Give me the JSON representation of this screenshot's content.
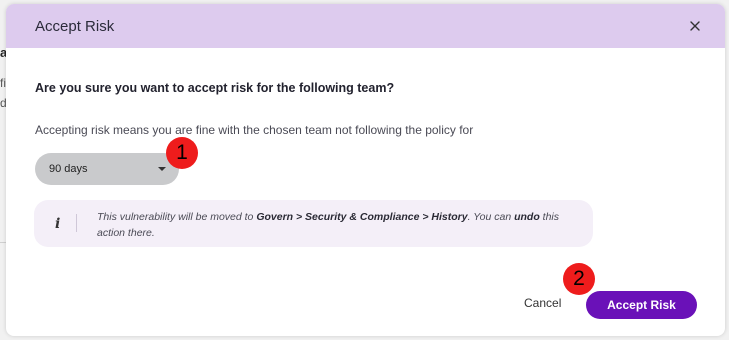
{
  "background": {
    "fragments": [
      "a",
      "fi",
      "d"
    ]
  },
  "modal": {
    "title": "Accept Risk",
    "close_icon": "close-icon",
    "question": "Are you sure you want to accept risk for the following team?",
    "description": "Accepting risk means you are fine with the chosen team not following the policy for",
    "duration_select": {
      "selected": "90 days"
    },
    "info": {
      "icon": "info-icon",
      "text_part1": "This vulnerability will be moved to ",
      "path": "Govern > Security & Compliance > History",
      "text_part2": ". You can ",
      "undo": "undo",
      "text_part3": " this action there."
    },
    "cancel_label": "Cancel",
    "accept_label": "Accept Risk"
  },
  "annotations": {
    "badge_1": "1",
    "badge_2": "2"
  },
  "colors": {
    "header_bg": "#ddcbee",
    "primary": "#6a11b8",
    "badge": "#ee1c1c",
    "info_bg": "#f4eff8"
  }
}
